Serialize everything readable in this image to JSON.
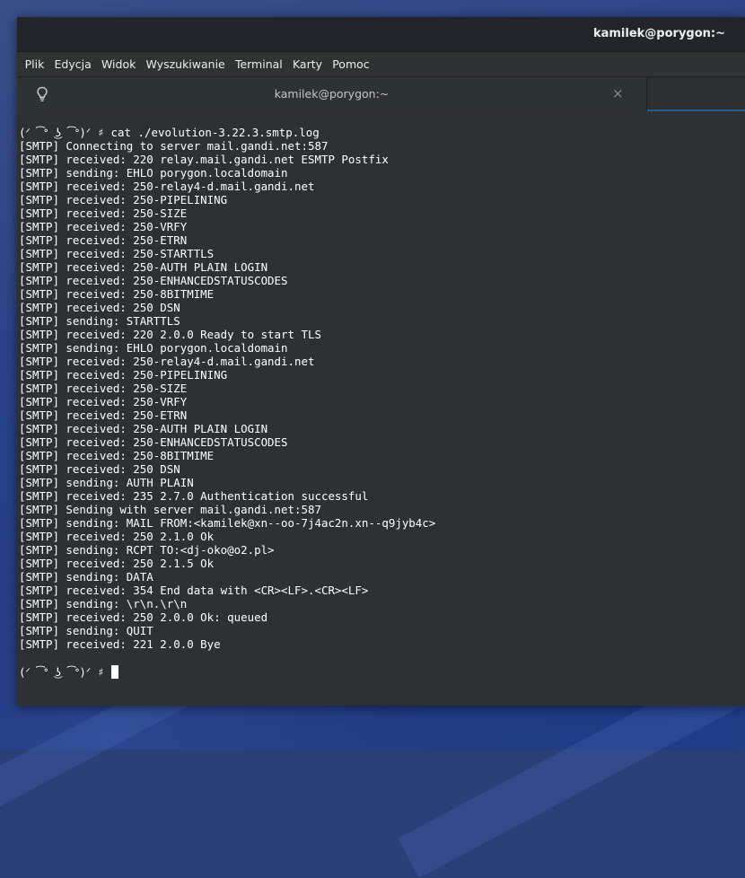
{
  "window": {
    "title": "kamilek@porygon:~"
  },
  "menu": [
    "Plik",
    "Edycja",
    "Widok",
    "Wyszukiwanie",
    "Terminal",
    "Karty",
    "Pomoc"
  ],
  "tab": {
    "title": "kamilek@porygon:~",
    "icon": "lightbulb-icon",
    "close": "×"
  },
  "terminal": {
    "lines": [
      "(ᐟ ͡ᐤ ͜ʖ ͡ᐤ)ᐟ ♯ cat ./evolution-3.22.3.smtp.log",
      "[SMTP] Connecting to server mail.gandi.net:587",
      "[SMTP] received: 220 relay.mail.gandi.net ESMTP Postfix",
      "[SMTP] sending: EHLO porygon.localdomain",
      "[SMTP] received: 250-relay4-d.mail.gandi.net",
      "[SMTP] received: 250-PIPELINING",
      "[SMTP] received: 250-SIZE",
      "[SMTP] received: 250-VRFY",
      "[SMTP] received: 250-ETRN",
      "[SMTP] received: 250-STARTTLS",
      "[SMTP] received: 250-AUTH PLAIN LOGIN",
      "[SMTP] received: 250-ENHANCEDSTATUSCODES",
      "[SMTP] received: 250-8BITMIME",
      "[SMTP] received: 250 DSN",
      "[SMTP] sending: STARTTLS",
      "[SMTP] received: 220 2.0.0 Ready to start TLS",
      "[SMTP] sending: EHLO porygon.localdomain",
      "[SMTP] received: 250-relay4-d.mail.gandi.net",
      "[SMTP] received: 250-PIPELINING",
      "[SMTP] received: 250-SIZE",
      "[SMTP] received: 250-VRFY",
      "[SMTP] received: 250-ETRN",
      "[SMTP] received: 250-AUTH PLAIN LOGIN",
      "[SMTP] received: 250-ENHANCEDSTATUSCODES",
      "[SMTP] received: 250-8BITMIME",
      "[SMTP] received: 250 DSN",
      "[SMTP] sending: AUTH PLAIN",
      "[SMTP] received: 235 2.7.0 Authentication successful",
      "[SMTP] Sending with server mail.gandi.net:587",
      "[SMTP] sending: MAIL FROM:<kamilek@xn--oo-7j4ac2n.xn--q9jyb4c>",
      "[SMTP] received: 250 2.1.0 Ok",
      "[SMTP] sending: RCPT TO:<dj-oko@o2.pl>",
      "[SMTP] received: 250 2.1.5 Ok",
      "[SMTP] sending: DATA",
      "[SMTP] received: 354 End data with <CR><LF>.<CR><LF>",
      "[SMTP] sending: \\r\\n.\\r\\n",
      "[SMTP] received: 250 2.0.0 Ok: queued",
      "[SMTP] sending: QUIT",
      "[SMTP] received: 221 2.0.0 Bye"
    ],
    "prompt": "(ᐟ ͡ᐤ ͜ʖ ͡ᐤ)ᐟ ♯ "
  }
}
